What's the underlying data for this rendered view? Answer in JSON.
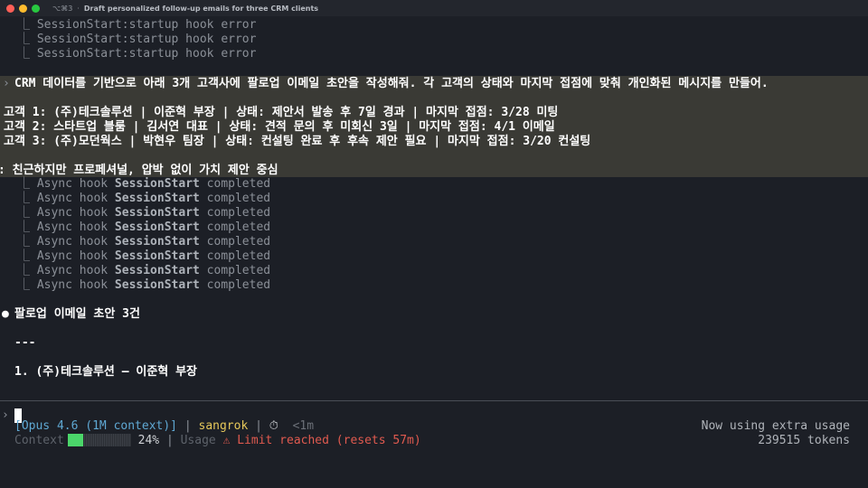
{
  "window": {
    "tab_shortcut": "⌥⌘3",
    "tab_title": "Draft personalized follow-up emails for three CRM clients"
  },
  "startup_errors": [
    "⎿ SessionStart:startup hook error",
    "⎿ SessionStart:startup hook error",
    "⎿ SessionStart:startup hook error"
  ],
  "prompt": {
    "marker": "›",
    "intro": "CRM 데이터를 기반으로 아래 3개 고객사에 팔로업 이메일 초안을 작성해줘. 각 고객의 상태와 마지막 접점에 맞춰 개인화된 메시지를 만들어.",
    "clients": [
      "고객 1: (주)테크솔루션 | 이준혁 부장 | 상태: 제안서 발송 후 7일 경과 | 마지막 접점: 3/28 미팅",
      "고객 2: 스타트업 블룸 | 김서연 대표 | 상태: 견적 문의 후 미회신 3일 | 마지막 접점: 4/1 이메일",
      "고객 3: (주)모던웍스 | 박현우 팀장 | 상태: 컨설팅 완료 후 후속 제안 필요 | 마지막 접점: 3/20 컨설팅"
    ],
    "tone": "톤: 친근하지만 프로페셔널, 압박 없이 가치 제안 중심"
  },
  "async_hooks": {
    "prefix": "⎿ Async hook ",
    "name": "SessionStart",
    "suffix": " completed",
    "count": 8
  },
  "response": {
    "bullet": "●",
    "heading": "팔로업 이메일 초안 3건",
    "rule": "---",
    "item1": "1. (주)테크솔루션 — 이준혁 부장"
  },
  "input": {
    "caret": "›",
    "value": ""
  },
  "status": {
    "model": "[Opus 4.6 (1M context)]",
    "separator": "|",
    "user": "sangrok",
    "timer_icon": "⏱",
    "elapsed": "<1m",
    "context_label": "Context",
    "context_percent": "24%",
    "context_fraction": 0.24,
    "usage_label": "Usage",
    "limit_text": "⚠ Limit reached (resets 57m)",
    "extra_usage": "Now using extra usage",
    "tokens": "239515 tokens"
  }
}
